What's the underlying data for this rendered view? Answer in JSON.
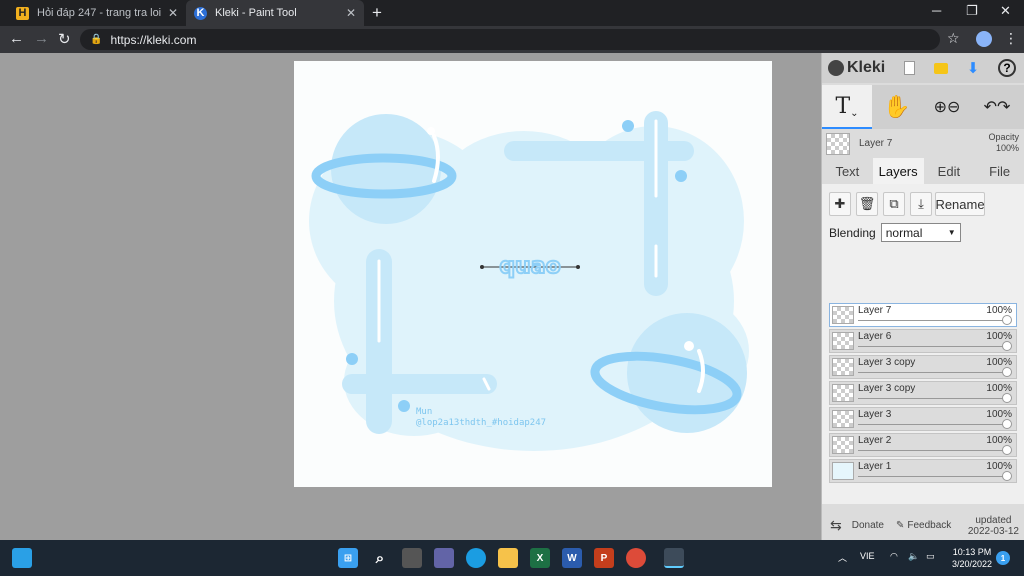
{
  "browser": {
    "tabs": [
      {
        "title": "Hỏi đáp 247 - trang tra loi",
        "favicon": "H",
        "active": false
      },
      {
        "title": "Kleki - Paint Tool",
        "favicon": "K",
        "active": true
      }
    ],
    "url": "https://kleki.com"
  },
  "canvas": {
    "title_text": "quao",
    "watermark_line1": "Mun",
    "watermark_line2": "@lop2a13thdth_#hoidap247",
    "colors": {
      "light": "#dff3fb",
      "mid": "#c6e8f9",
      "strong": "#8dcff7",
      "bg": "#fbfdfd"
    }
  },
  "app": {
    "name": "Kleki",
    "layer_name": "Layer 7",
    "opacity_label": "Opacity",
    "opacity_value": "100%",
    "tabs": [
      "Text",
      "Layers",
      "Edit",
      "File"
    ],
    "active_tab": "Layers",
    "rename_label": "Rename",
    "blending_label": "Blending",
    "blending_value": "normal",
    "layers": [
      {
        "name": "Layer 7",
        "opacity": "100%",
        "active": true
      },
      {
        "name": "Layer 6",
        "opacity": "100%",
        "active": false
      },
      {
        "name": "Layer 3 copy",
        "opacity": "100%",
        "active": false
      },
      {
        "name": "Layer 3 copy",
        "opacity": "100%",
        "active": false
      },
      {
        "name": "Layer 3",
        "opacity": "100%",
        "active": false
      },
      {
        "name": "Layer 2",
        "opacity": "100%",
        "active": false
      },
      {
        "name": "Layer 1",
        "opacity": "100%",
        "active": false
      }
    ],
    "footer": {
      "donate": "Donate",
      "feedback": "Feedback",
      "updated_label": "updated",
      "updated_date": "2022-03-12"
    }
  },
  "taskbar": {
    "lang": "VIE",
    "time": "10:13 PM",
    "date": "3/20/2022",
    "notification_count": "1"
  }
}
